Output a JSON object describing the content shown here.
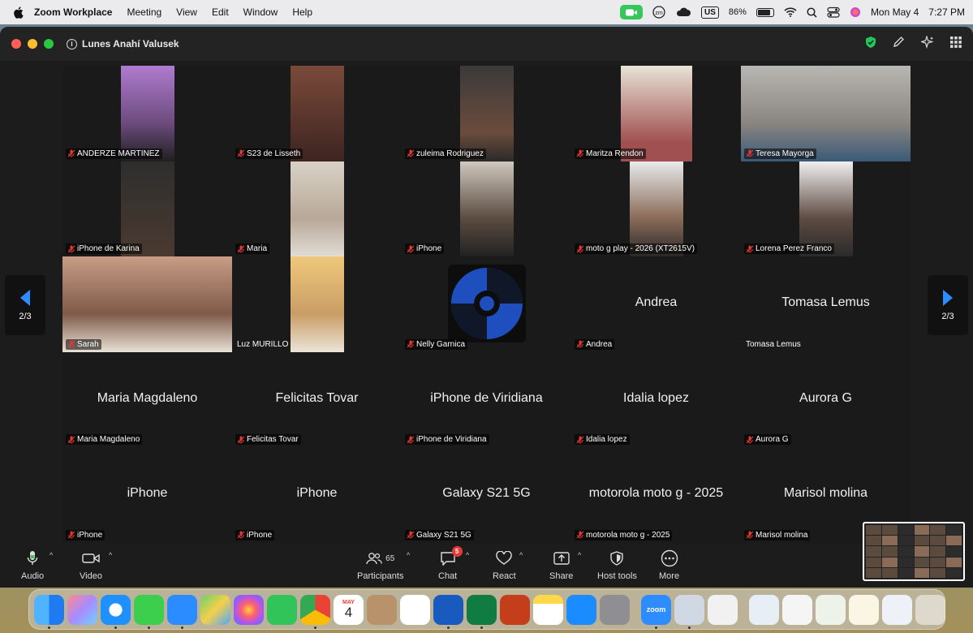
{
  "menubar": {
    "app_name": "Zoom Workplace",
    "menus": [
      "Meeting",
      "View",
      "Edit",
      "Window",
      "Help"
    ],
    "input_source": "US",
    "battery_percent": "86%",
    "battery_level": 0.86,
    "date": "Mon May 4",
    "time": "7:27 PM"
  },
  "window": {
    "meeting_title": "Lunes Anahí Valusek"
  },
  "gallery": {
    "tiles": [
      {
        "name": "ANDERZE MARTINEZ",
        "video": true
      },
      {
        "name": "S23 de Lisseth",
        "video": true
      },
      {
        "name": "zuleima Rodriguez",
        "video": true
      },
      {
        "name": "Maritza Rendon",
        "video": true
      },
      {
        "name": "Teresa Mayorga",
        "video": true
      },
      {
        "name": "iPhone de Karina",
        "video": true
      },
      {
        "name": "Maria",
        "video": true
      },
      {
        "name": "iPhone",
        "video": true
      },
      {
        "name": "moto g play - 2026 (XT2615V)",
        "video": true
      },
      {
        "name": "Lorena Perez Franco",
        "video": true
      },
      {
        "name": "Sarah",
        "video": true
      },
      {
        "name": "Luz MURILLO",
        "video": true
      },
      {
        "name": "Nelly Garnica",
        "video": false
      },
      {
        "name": "Andrea",
        "display": "Andrea",
        "video": false
      },
      {
        "name": "Tomasa Lemus",
        "display": "Tomasa Lemus",
        "video": false
      },
      {
        "name": "Maria Magdaleno",
        "display": "Maria Magdaleno",
        "video": false
      },
      {
        "name": "Felicitas Tovar",
        "display": "Felicitas Tovar",
        "video": false
      },
      {
        "name": "iPhone de Viridiana",
        "display": "iPhone de Viridiana",
        "video": false
      },
      {
        "name": "Idalia lopez",
        "display": "Idalia lopez",
        "video": false
      },
      {
        "name": "Aurora G",
        "display": "Aurora G",
        "video": false
      },
      {
        "name": "iPhone",
        "display": "iPhone",
        "video": false
      },
      {
        "name": "iPhone",
        "display": "iPhone",
        "video": false
      },
      {
        "name": "Galaxy S21 5G",
        "display": "Galaxy S21 5G",
        "video": false
      },
      {
        "name": "motorola moto g - 2025",
        "display": "motorola moto g - 2025",
        "video": false
      },
      {
        "name": "Marisol molina",
        "display": "Marisol molina",
        "video": false
      }
    ]
  },
  "pager": {
    "left_label": "2/3",
    "right_label": "2/3"
  },
  "toolbar": {
    "audio": "Audio",
    "video": "Video",
    "participants": "Participants",
    "participants_count": "65",
    "chat": "Chat",
    "chat_badge": "5",
    "react": "React",
    "share": "Share",
    "host_tools": "Host tools",
    "more": "More"
  },
  "dock": {
    "calendar_month": "MAY",
    "calendar_day": "4",
    "zoom_label": "zoom"
  },
  "colors": {
    "accent_green": "#35c759",
    "mute_red": "#e53935",
    "pager_blue": "#2d8cff"
  }
}
